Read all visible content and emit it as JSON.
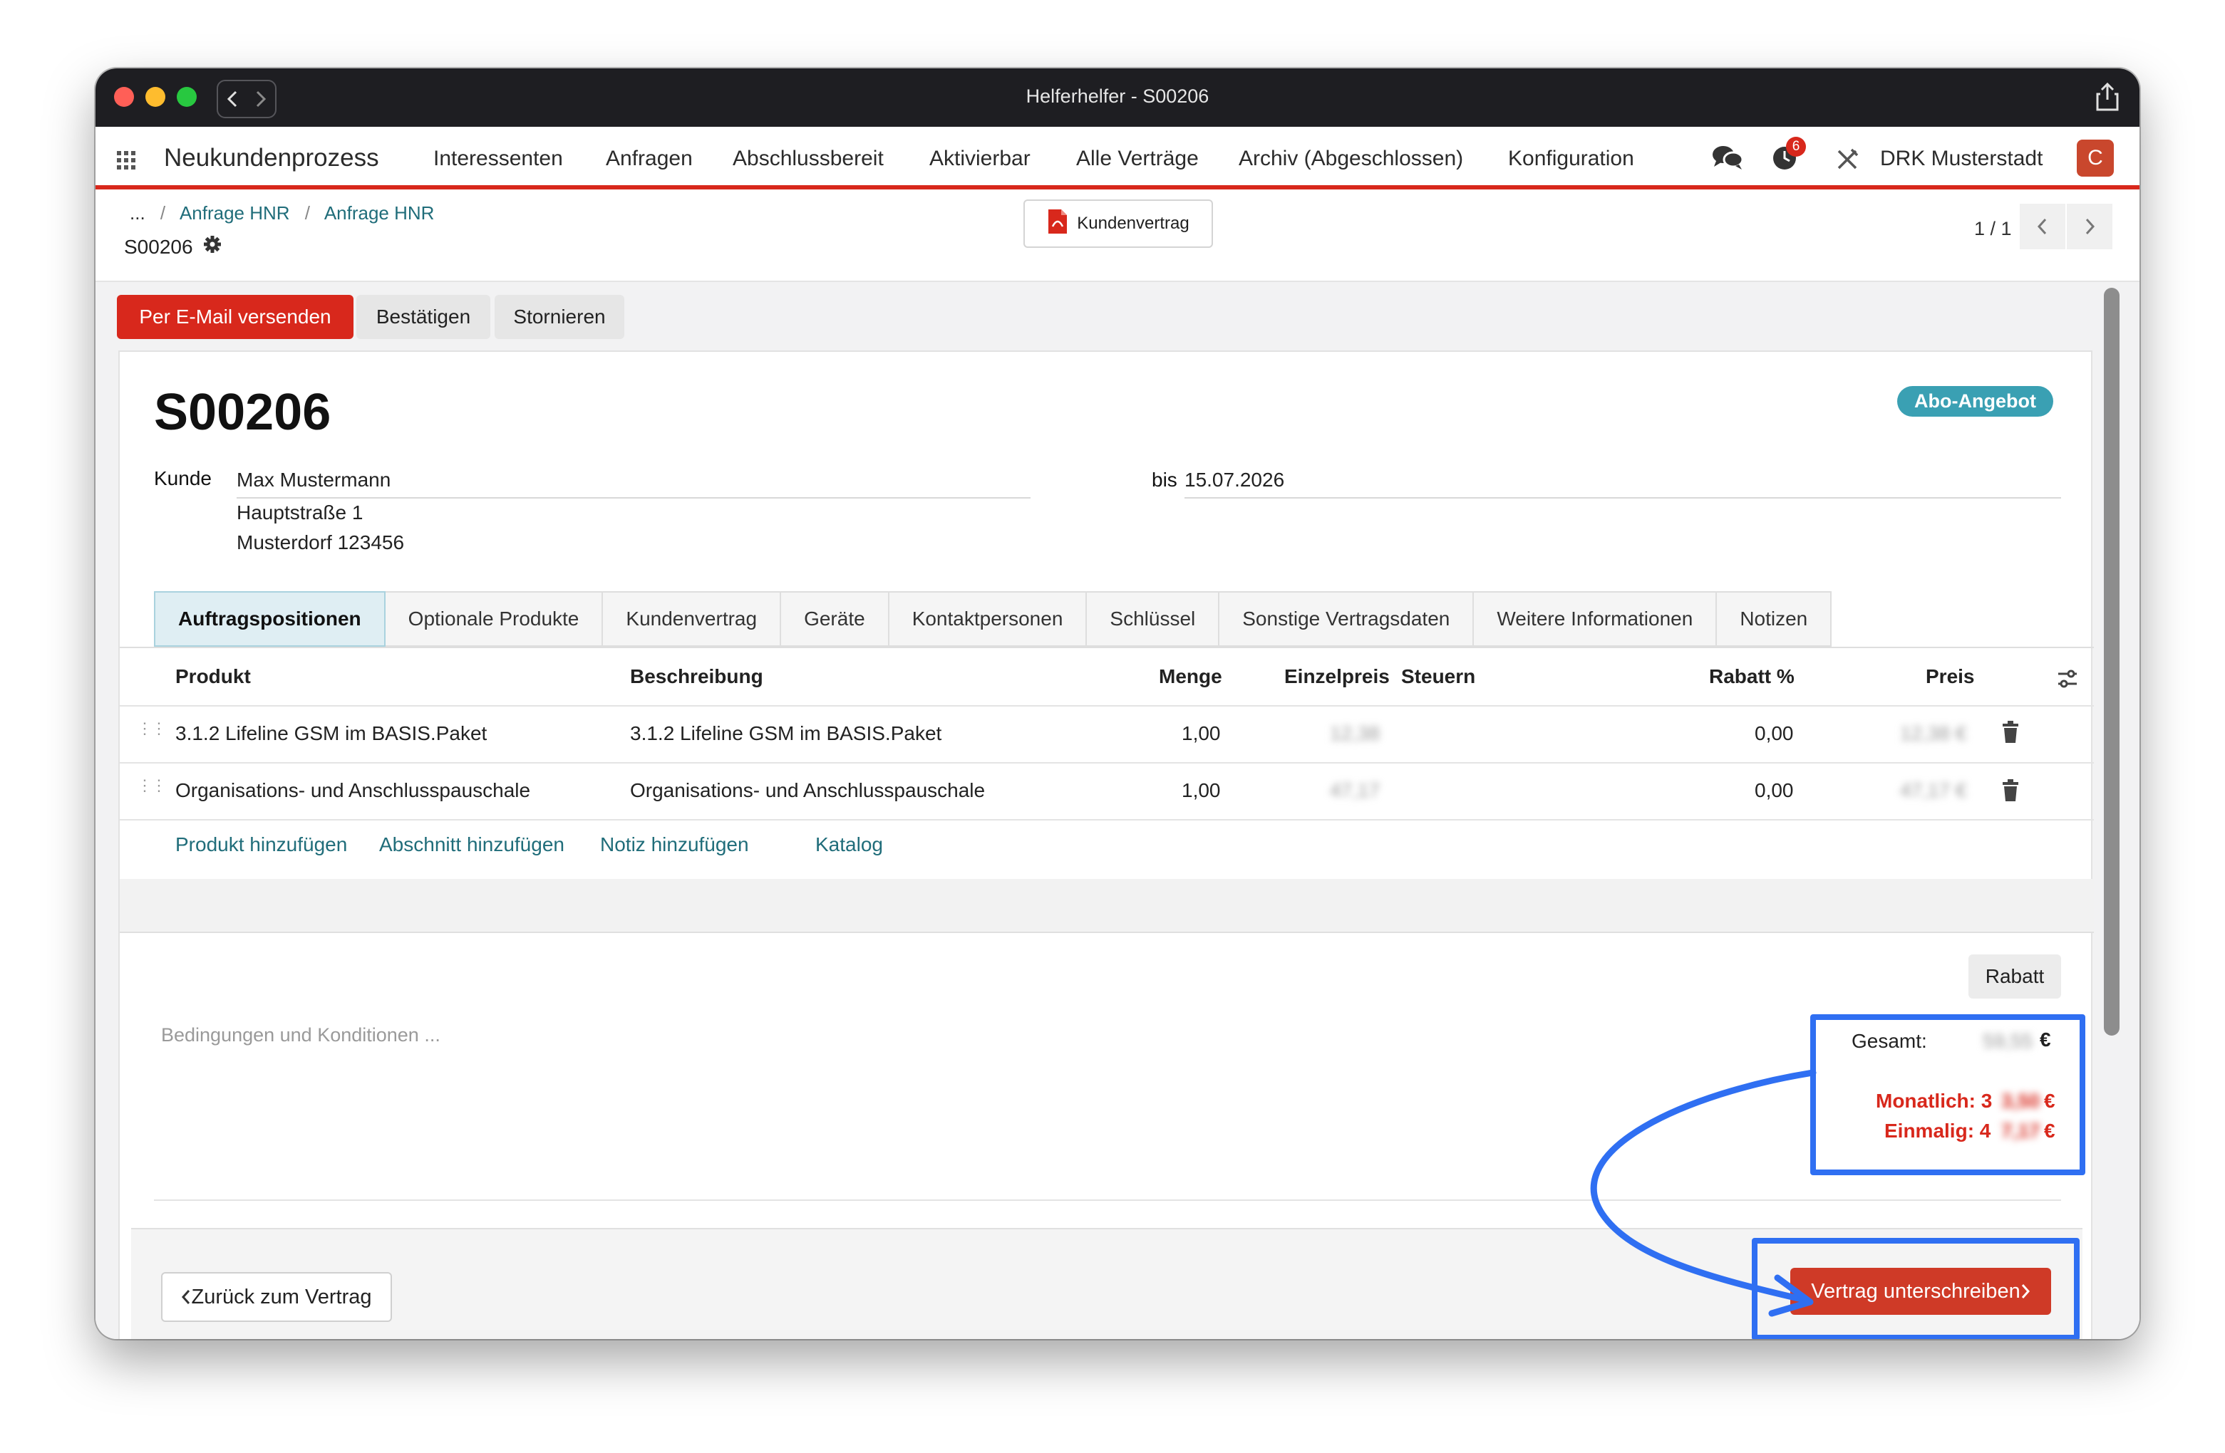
{
  "window": {
    "title": "Helferhelfer - S00206"
  },
  "navbar": {
    "brand": "Neukundenprozess",
    "menu": [
      "Interessenten",
      "Anfragen",
      "Abschlussbereit",
      "Aktivierbar",
      "Alle Verträge",
      "Archiv (Abgeschlossen)",
      "Konfiguration"
    ],
    "activity_count": "6",
    "company": "DRK Musterstadt",
    "avatar_letter": "C"
  },
  "breadcrumb": {
    "more": "...",
    "items": [
      "Anfrage HNR",
      "Anfrage HNR"
    ],
    "current": "S00206"
  },
  "smart_button": {
    "label": "Kundenvertrag"
  },
  "pager": {
    "value": "1 / 1"
  },
  "actions": {
    "email": "Per E-Mail versenden",
    "confirm": "Bestätigen",
    "cancel": "Stornieren"
  },
  "record": {
    "name": "S00206",
    "tag": "Abo-Angebot",
    "customer_label": "Kunde",
    "customer_name": "Max Mustermann",
    "customer_street": "Hauptstraße 1",
    "customer_city": "Musterdorf 123456",
    "validity_label": "bis",
    "validity_date": "15.07.2026"
  },
  "tabs": [
    "Auftragspositionen",
    "Optionale Produkte",
    "Kundenvertrag",
    "Geräte",
    "Kontaktpersonen",
    "Schlüssel",
    "Sonstige Vertragsdaten",
    "Weitere Informationen",
    "Notizen"
  ],
  "table": {
    "headers": {
      "product": "Produkt",
      "description": "Beschreibung",
      "qty": "Menge",
      "unit_price": "Einzelpreis",
      "taxes": "Steuern",
      "discount": "Rabatt %",
      "price": "Preis"
    },
    "rows": [
      {
        "product": "3.1.2 Lifeline GSM im BASIS.Paket",
        "description": "3.1.2 Lifeline GSM im BASIS.Paket",
        "qty": "1,00",
        "unit_price": "12,38",
        "discount": "0,00",
        "price": "12,38 €"
      },
      {
        "product": "Organisations- und Anschlusspauschale",
        "description": "Organisations- und Anschlusspauschale",
        "qty": "1,00",
        "unit_price": "47,17",
        "discount": "0,00",
        "price": "47,17 €"
      }
    ],
    "add_links": {
      "product": "Produkt hinzufügen",
      "section": "Abschnitt hinzufügen",
      "note": "Notiz hinzufügen",
      "catalog": "Katalog"
    }
  },
  "totals": {
    "discount_button": "Rabatt",
    "terms_placeholder": "Bedingungen und Konditionen ...",
    "total_label": "Gesamt:",
    "total_value": "59,55",
    "currency": "€",
    "monthly_label": "Monatlich: 3",
    "monthly_hidden": "3,50",
    "once_label": "Einmalig: 4",
    "once_hidden": "7,17"
  },
  "footer": {
    "back": "Zurück zum Vertrag",
    "sign": "Vertrag unterschreiben"
  },
  "colors": {
    "accent_red": "#d8281c",
    "teal_link": "#206d7a",
    "highlight_blue": "#2f6ff2"
  }
}
